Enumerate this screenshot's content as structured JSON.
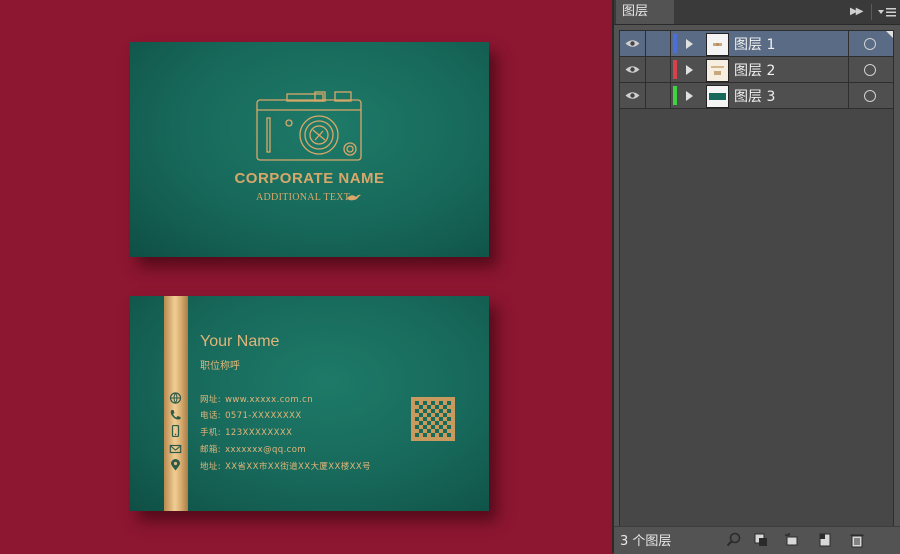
{
  "canvas": {
    "front_card": {
      "corporate_name": "CORPORATE NAME",
      "additional_text": "ADDITIONAL TEXT"
    },
    "back_card": {
      "name": "Your Name",
      "job_title": "职位称呼",
      "contacts": [
        {
          "label": "网址:",
          "value": "www.xxxxx.com.cn",
          "icon": "globe-icon"
        },
        {
          "label": "电话:",
          "value": "0571-XXXXXXXX",
          "icon": "phone-icon"
        },
        {
          "label": "手机:",
          "value": "123XXXXXXXX",
          "icon": "mobile-icon"
        },
        {
          "label": "邮箱:",
          "value": "xxxxxxx@qq.com",
          "icon": "mail-icon"
        },
        {
          "label": "地址:",
          "value": "XX省XX市XX街道XX大厦XX楼XX号",
          "icon": "location-icon"
        }
      ]
    }
  },
  "layers_panel": {
    "tab_label": "图层",
    "layers": [
      {
        "name": "图层 1",
        "color": "#4a6fd8",
        "selected": true
      },
      {
        "name": "图层 2",
        "color": "#d8404a",
        "selected": false
      },
      {
        "name": "图层 3",
        "color": "#3fd43f",
        "selected": false
      }
    ],
    "footer_count": "3 个图层"
  },
  "colors": {
    "background": "#8d1631",
    "card_green": "#17685a",
    "gold": "#d8b07a",
    "selection": "#5a6b85"
  }
}
